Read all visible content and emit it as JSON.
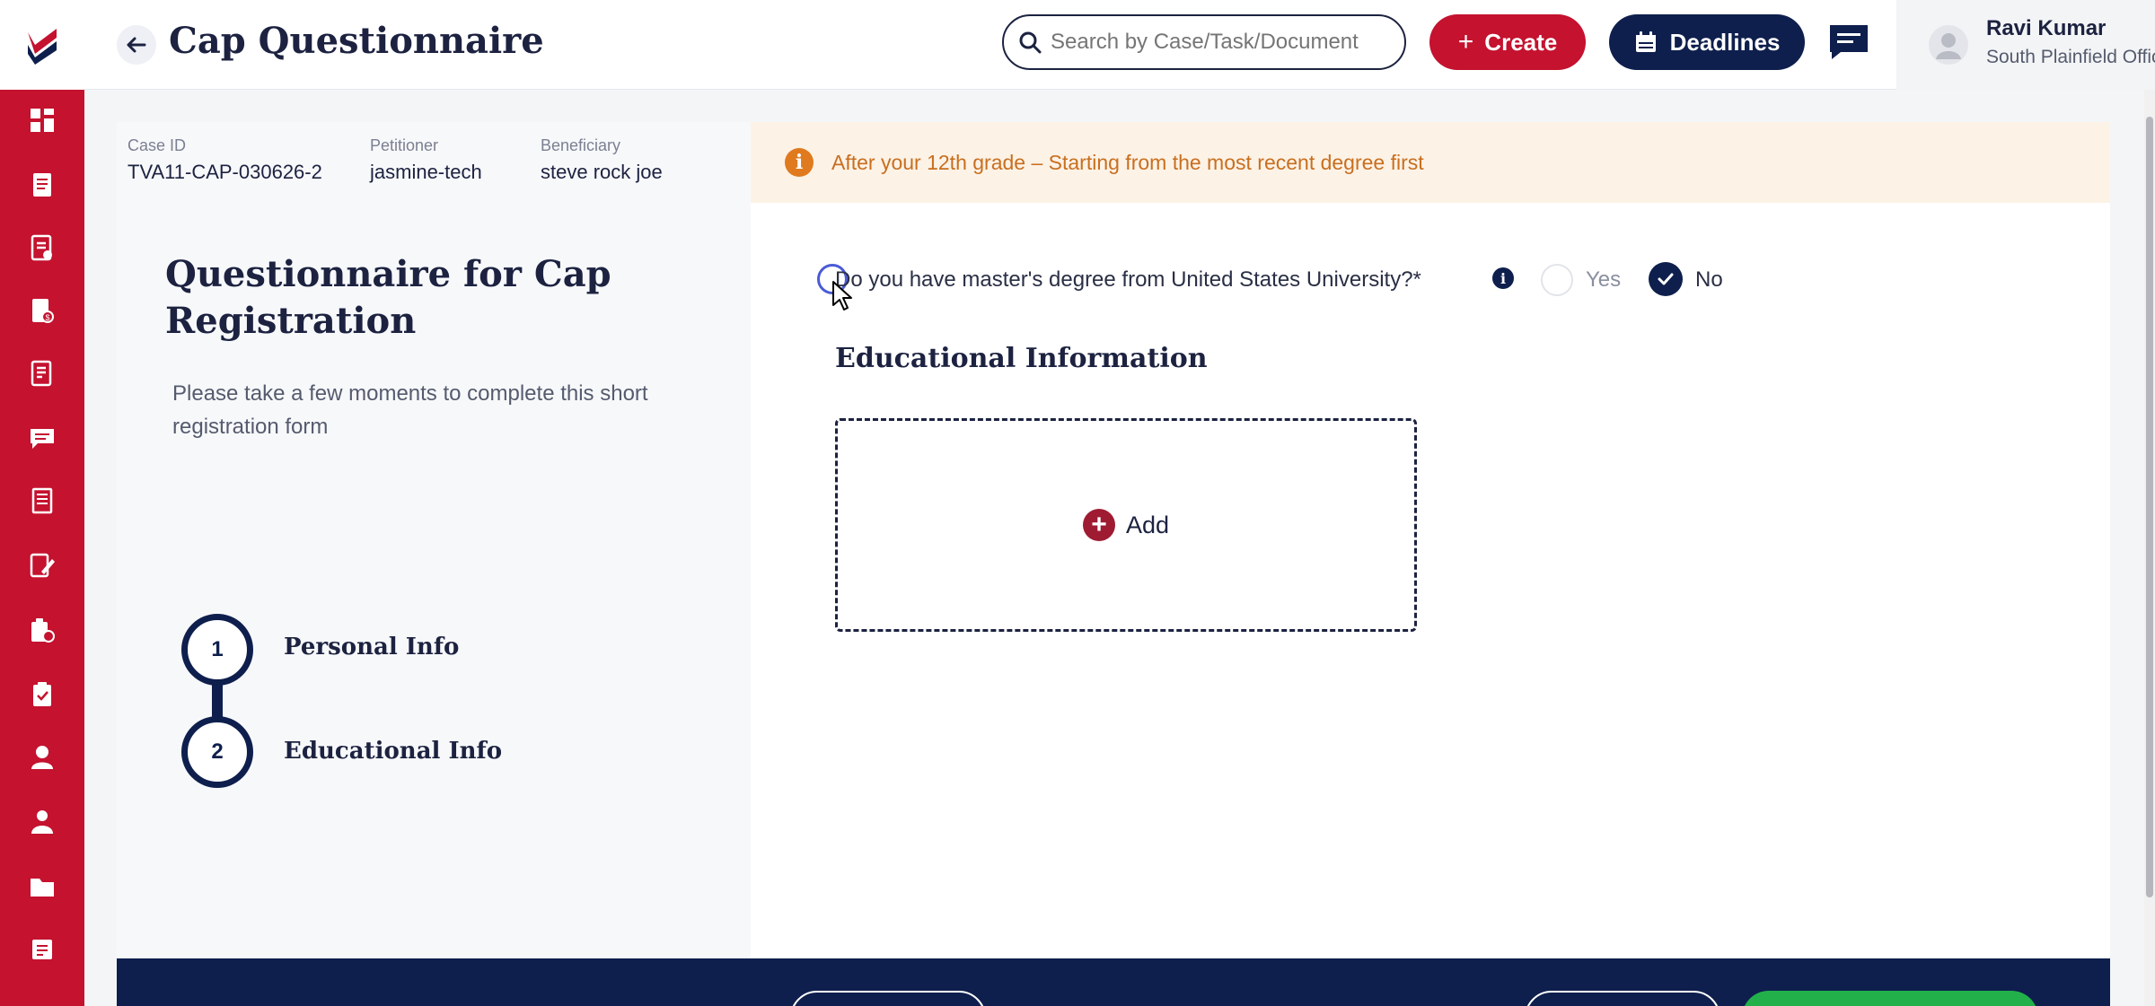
{
  "header": {
    "title": "Cap Questionnaire",
    "search_placeholder": "Search by Case/Task/Document",
    "create_label": "Create",
    "deadlines_label": "Deadlines",
    "user": {
      "name": "Ravi Kumar",
      "office": "South Plainfield Office"
    }
  },
  "case_info": {
    "case_id_label": "Case ID",
    "case_id": "TVA11-CAP-030626-2",
    "petitioner_label": "Petitioner",
    "petitioner": "jasmine-tech",
    "beneficiary_label": "Beneficiary",
    "beneficiary": "steve rock joe"
  },
  "notice": {
    "text": "After your 12th grade – Starting from the most recent degree first"
  },
  "left_panel": {
    "title": "Questionnaire for Cap Registration",
    "subtitle": "Please take a few moments to complete this short registration form",
    "steps": [
      {
        "number": "1",
        "label": "Personal Info"
      },
      {
        "number": "2",
        "label": "Educational Info"
      }
    ]
  },
  "question": {
    "text": "Do you have master's degree from United States University?*",
    "options": [
      {
        "label": "Yes",
        "selected": false
      },
      {
        "label": "No",
        "selected": true
      }
    ]
  },
  "section": {
    "title": "Educational Information",
    "add_label": "Add"
  },
  "colors": {
    "brand_red": "#c4122f",
    "navy": "#0e1f4d",
    "notice_bg": "#fdf2e6",
    "notice_text": "#c86f1f",
    "green": "#22b04b"
  },
  "icons": {
    "sidebar": [
      "dashboard-icon",
      "document-icon",
      "checklist-icon",
      "billing-icon",
      "form-icon",
      "chat-icon",
      "book-icon",
      "edit-icon",
      "case-icon",
      "task-icon",
      "user-icon",
      "team-icon",
      "folder-icon",
      "notes-icon"
    ]
  }
}
